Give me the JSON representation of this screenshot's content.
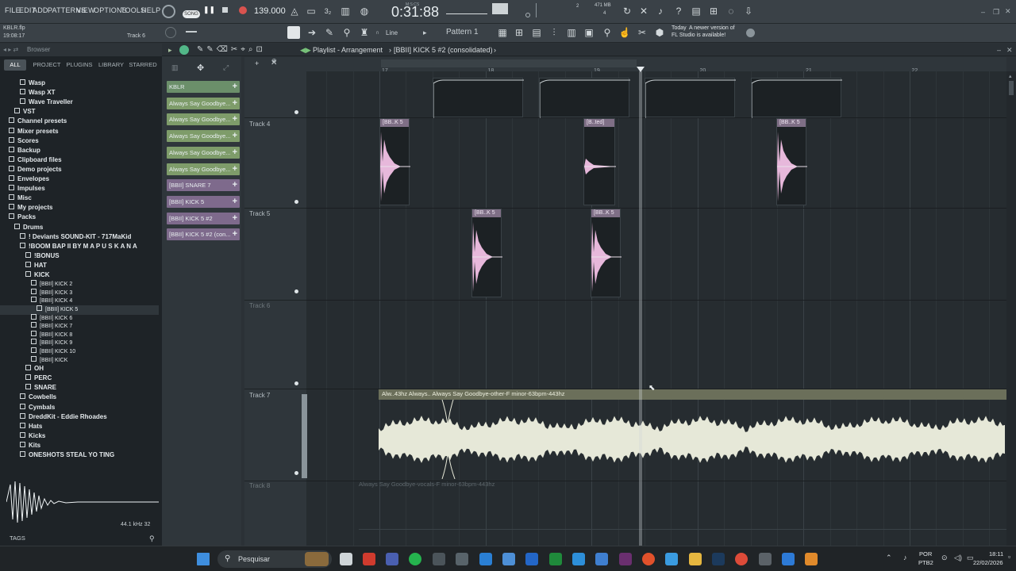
{
  "menu": [
    "FILE",
    "EDIT",
    "ADD",
    "PATTERNS",
    "VIEW",
    "OPTIONS",
    "TOOLS",
    "HELP"
  ],
  "transport": {
    "mode": "SONG",
    "tempo": "139.000",
    "time": "0:31:88",
    "time_unit": "M:S:CS",
    "cpu_mem": "471 MB",
    "beat_num": "2",
    "beat_den": "4"
  },
  "project": {
    "file": "KBLR.flp",
    "time": "19:08:17",
    "focus": "Track 6"
  },
  "toolbar2": {
    "snap": "Line",
    "pattern": "Pattern 1"
  },
  "news": {
    "day": "Today",
    "text1": "A newer version of",
    "text2": "FL Studio is available!"
  },
  "browser": {
    "title": "Browser",
    "tabs": [
      "ALL",
      "PROJECT",
      "PLUGINS",
      "LIBRARY",
      "STARRED"
    ],
    "items": [
      {
        "label": "Wasp",
        "indent": 3
      },
      {
        "label": "Wasp XT",
        "indent": 3
      },
      {
        "label": "Wave Traveller",
        "indent": 3
      },
      {
        "label": "VST",
        "indent": 2
      },
      {
        "label": "Channel presets",
        "indent": 1
      },
      {
        "label": "Mixer presets",
        "indent": 1
      },
      {
        "label": "Scores",
        "indent": 1
      },
      {
        "label": "Backup",
        "indent": 1
      },
      {
        "label": "Clipboard files",
        "indent": 1
      },
      {
        "label": "Demo projects",
        "indent": 1
      },
      {
        "label": "Envelopes",
        "indent": 1
      },
      {
        "label": "Impulses",
        "indent": 1
      },
      {
        "label": "Misc",
        "indent": 1
      },
      {
        "label": "My projects",
        "indent": 1
      },
      {
        "label": "Packs",
        "indent": 1
      },
      {
        "label": "Drums",
        "indent": 2
      },
      {
        "label": "! Deviants SOUND-KIT - 717MaKid",
        "indent": 3
      },
      {
        "label": "!BOOM BAP II BY M A P U S K A N A",
        "indent": 3
      },
      {
        "label": "!BONUS",
        "indent": 4
      },
      {
        "label": "HAT",
        "indent": 4
      },
      {
        "label": "KICK",
        "indent": 4
      },
      {
        "label": "[BBII] KICK 2",
        "indent": 5
      },
      {
        "label": "[BBII] KICK 3",
        "indent": 5
      },
      {
        "label": "[BBII] KICK 4",
        "indent": 5
      },
      {
        "label": "[BBII] KICK 5",
        "indent": 6
      },
      {
        "label": "[BBII] KICK 6",
        "indent": 5
      },
      {
        "label": "[BBII] KICK 7",
        "indent": 5
      },
      {
        "label": "[BBII] KICK 8",
        "indent": 5
      },
      {
        "label": "[BBII] KICK 9",
        "indent": 5
      },
      {
        "label": "[BBII] KICK 10",
        "indent": 5
      },
      {
        "label": "[BBII] KICK",
        "indent": 5
      },
      {
        "label": "OH",
        "indent": 4
      },
      {
        "label": "PERC",
        "indent": 4
      },
      {
        "label": "SNARE",
        "indent": 4
      },
      {
        "label": "Cowbells",
        "indent": 3
      },
      {
        "label": "Cymbals",
        "indent": 3
      },
      {
        "label": "DreddKit - Eddie Rhoades",
        "indent": 3
      },
      {
        "label": "Hats",
        "indent": 3
      },
      {
        "label": "Kicks",
        "indent": 3
      },
      {
        "label": "Kits",
        "indent": 3
      },
      {
        "label": "ONESHOTS STEAL YO TING",
        "indent": 3
      }
    ],
    "sample_info": "44.1 kHz 32",
    "tags_label": "TAGS"
  },
  "channels": [
    {
      "label": "KBLR",
      "color": "#6b8f6a"
    },
    {
      "label": "Always Say Goodbye...",
      "color": "#7e9c6a"
    },
    {
      "label": "Always Say Goodbye...",
      "color": "#7e9c6a"
    },
    {
      "label": "Always Say Goodbye...",
      "color": "#7e9c6a"
    },
    {
      "label": "Always Say Goodbye...",
      "color": "#7e9c6a"
    },
    {
      "label": "Always Say Goodbye...",
      "color": "#7e9c6a"
    },
    {
      "label": "[BBII] SNARE 7",
      "color": "#7e6a8c"
    },
    {
      "label": "[BBII] KICK 5",
      "color": "#7e6a8c"
    },
    {
      "label": "[BBII] KICK 5 #2",
      "color": "#7e6a8c"
    },
    {
      "label": "[BBII] KICK 5 #2 (con...",
      "color": "#7e6a8c"
    }
  ],
  "playlist": {
    "title": "Playlist - Arrangement",
    "breadcrumb": "[BBII] KICK 5 #2 (consolidated)",
    "ruler": [
      "17",
      "18",
      "19",
      "20",
      "21",
      "22"
    ],
    "tracks": [
      "Track 4",
      "Track 5",
      "Track 6",
      "Track 7",
      "Track 8"
    ],
    "clips_t4": [
      "[BB..K 5",
      "[B..ted]",
      "[BB..K 5"
    ],
    "clips_t5": [
      "[BB..K 5",
      "[BB..K 5"
    ],
    "audio_t7": "Alw..43hz  Always..  Always Say Goodbye-other-F minor-63bpm-443hz",
    "audio_t8": "Always Say Goodbye-vocals-F minor-63bpm-443hz"
  },
  "taskbar": {
    "search": "Pesquisar",
    "lang1": "POR",
    "lang2": "PTB2",
    "clock": "18:11",
    "date": "22/02/2026"
  }
}
